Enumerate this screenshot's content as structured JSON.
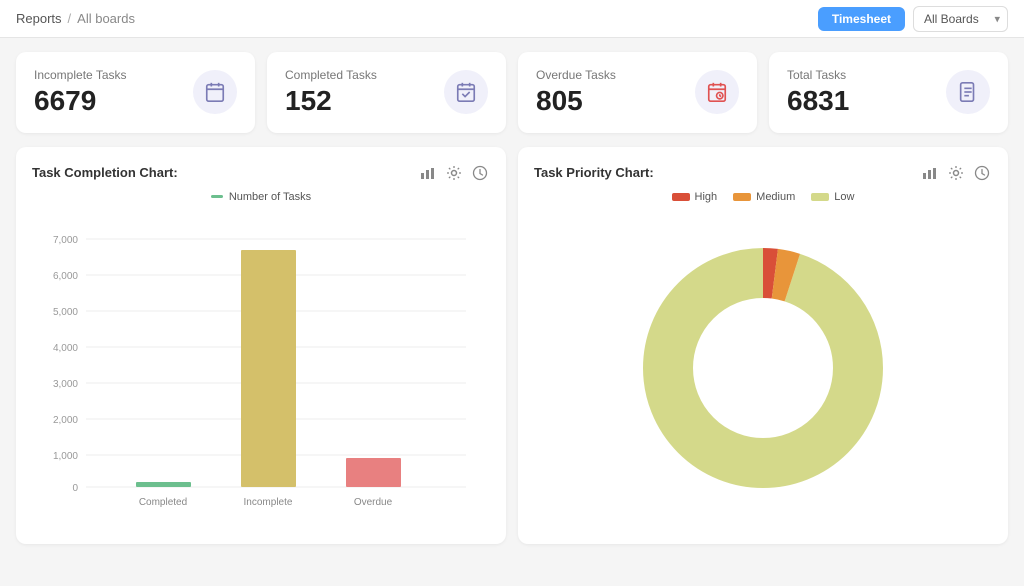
{
  "breadcrumb": {
    "reports": "Reports",
    "separator": "/",
    "boards": "All boards"
  },
  "header": {
    "timesheet_label": "Timesheet",
    "all_boards_label": "All Boards"
  },
  "stat_cards": [
    {
      "id": "incomplete",
      "label": "Incomplete Tasks",
      "value": "6679",
      "icon": "calendar-icon",
      "icon_color": "#7b7bb5"
    },
    {
      "id": "completed",
      "label": "Completed Tasks",
      "value": "152",
      "icon": "check-calendar-icon",
      "icon_color": "#7b7bb5"
    },
    {
      "id": "overdue",
      "label": "Overdue Tasks",
      "value": "805",
      "icon": "overdue-icon",
      "icon_color": "#e05252"
    },
    {
      "id": "total",
      "label": "Total Tasks",
      "value": "6831",
      "icon": "total-icon",
      "icon_color": "#7b7bb5"
    }
  ],
  "task_completion_chart": {
    "title": "Task Completion Chart:",
    "legend_label": "Number of Tasks",
    "legend_color": "#6cbf8e",
    "y_labels": [
      "7,000",
      "6,000",
      "5,000",
      "4,000",
      "3,000",
      "2,000",
      "1,000",
      "0"
    ],
    "bars": [
      {
        "label": "Completed",
        "value": 152,
        "max": 7000,
        "color": "#6cbf8e"
      },
      {
        "label": "Incomplete",
        "value": 6679,
        "max": 7000,
        "color": "#d4c06a"
      },
      {
        "label": "Overdue",
        "value": 805,
        "max": 7000,
        "color": "#e88080"
      }
    ]
  },
  "task_priority_chart": {
    "title": "Task Priority Chart:",
    "legend": [
      {
        "label": "High",
        "color": "#d94f38"
      },
      {
        "label": "Medium",
        "color": "#e8953a"
      },
      {
        "label": "Low",
        "color": "#d4d98a"
      }
    ],
    "segments": [
      {
        "label": "High",
        "value": 2,
        "color": "#d94f38"
      },
      {
        "label": "Medium",
        "value": 3,
        "color": "#e8953a"
      },
      {
        "label": "Low",
        "value": 95,
        "color": "#d4d98a"
      }
    ]
  }
}
